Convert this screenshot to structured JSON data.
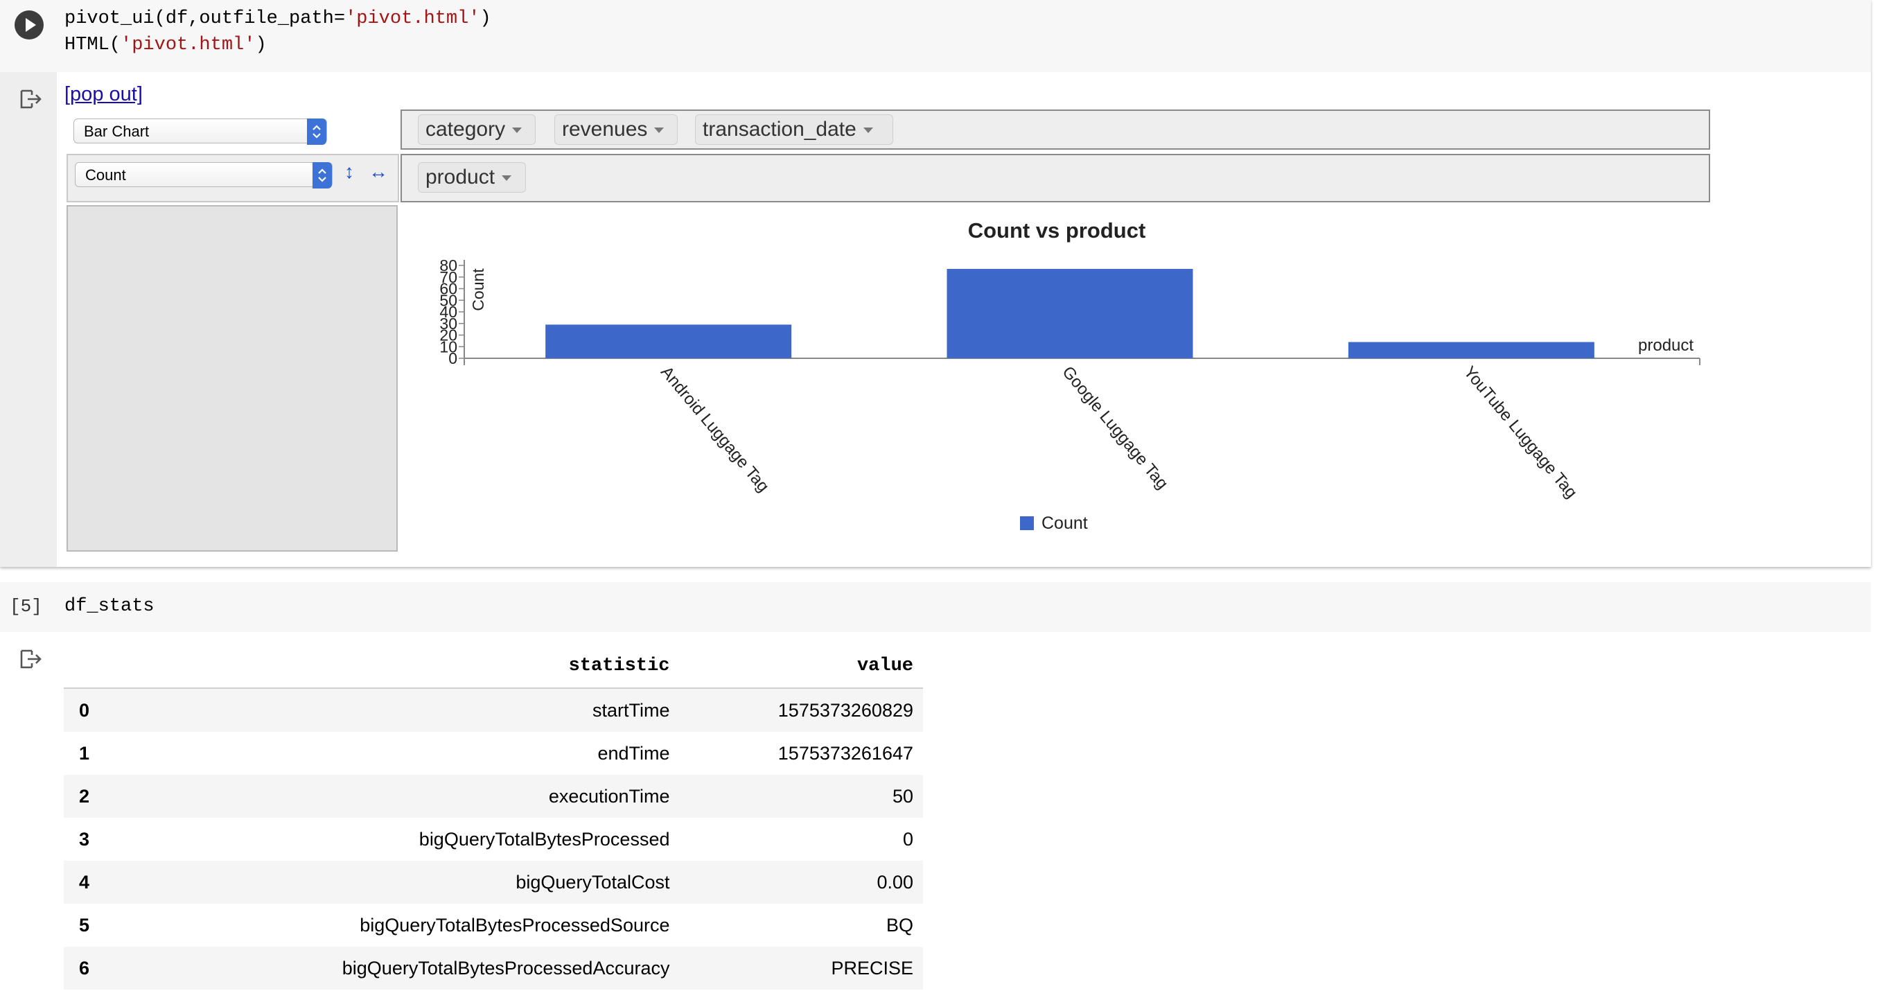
{
  "cell1": {
    "code_line1_prefix": "pivot_ui(df,outfile_path=",
    "code_line1_string": "'pivot.html'",
    "code_line1_suffix": ")",
    "code_line2_prefix": "HTML(",
    "code_line2_string": "'pivot.html'",
    "code_line2_suffix": ")"
  },
  "pivot": {
    "popout_label": "[pop out]",
    "renderer": "Bar Chart",
    "aggregator": "Count",
    "sort_row_icon": "↕",
    "sort_col_icon": "↔",
    "col_fields": [
      "category",
      "revenues",
      "transaction_date"
    ],
    "row_fields": [
      "product"
    ]
  },
  "chart_data": {
    "type": "bar",
    "title": "Count vs product",
    "xlabel": "product",
    "ylabel": "Count",
    "categories": [
      "Android Luggage Tag",
      "Google Luggage Tag",
      "YouTube Luggage Tag"
    ],
    "series": [
      {
        "name": "Count",
        "values": [
          29,
          77,
          14
        ]
      }
    ],
    "yticks": [
      "0",
      "10",
      "20",
      "30",
      "40",
      "50",
      "60",
      "70",
      "80"
    ],
    "ylim": [
      0,
      80
    ],
    "legend_position": "bottom",
    "color": "#3d67c9"
  },
  "cell2": {
    "exec_count": "[5]",
    "code": "df_stats"
  },
  "table": {
    "headers": [
      "statistic",
      "value"
    ],
    "rows": [
      {
        "idx": "0",
        "statistic": "startTime",
        "value": "1575373260829"
      },
      {
        "idx": "1",
        "statistic": "endTime",
        "value": "1575373261647"
      },
      {
        "idx": "2",
        "statistic": "executionTime",
        "value": "50"
      },
      {
        "idx": "3",
        "statistic": "bigQueryTotalBytesProcessed",
        "value": "0"
      },
      {
        "idx": "4",
        "statistic": "bigQueryTotalCost",
        "value": "0.00"
      },
      {
        "idx": "5",
        "statistic": "bigQueryTotalBytesProcessedSource",
        "value": "BQ"
      },
      {
        "idx": "6",
        "statistic": "bigQueryTotalBytesProcessedAccuracy",
        "value": "PRECISE"
      }
    ]
  }
}
